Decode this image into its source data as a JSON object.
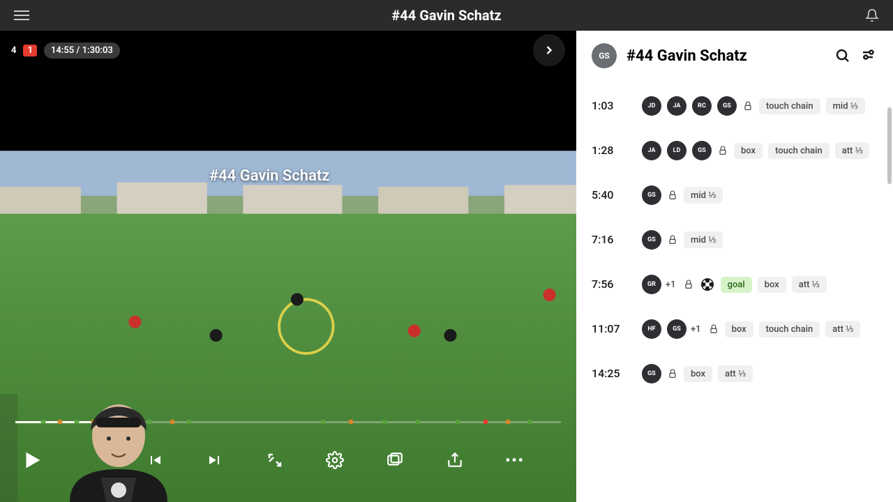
{
  "header": {
    "title": "#44 Gavin Schatz"
  },
  "video": {
    "score_a": "4",
    "score_b": "1",
    "time_current": "14:55",
    "time_total": "1:30:03",
    "overlay_title": "#44 Gavin Schatz"
  },
  "sidebar": {
    "avatar_initials": "GS",
    "title": "#44 Gavin Schatz"
  },
  "markers": [
    {
      "pos": 5,
      "color": "#5aa23a"
    },
    {
      "pos": 8,
      "color": "#d6852a"
    },
    {
      "pos": 11,
      "color": "#5aa23a"
    },
    {
      "pos": 14,
      "color": "#d6852a"
    },
    {
      "pos": 24,
      "color": "#5aa23a"
    },
    {
      "pos": 28,
      "color": "#d6852a"
    },
    {
      "pos": 31,
      "color": "#5aa23a"
    },
    {
      "pos": 55,
      "color": "#5aa23a"
    },
    {
      "pos": 60,
      "color": "#d6852a"
    },
    {
      "pos": 66,
      "color": "#5aa23a"
    },
    {
      "pos": 72,
      "color": "#5aa23a"
    },
    {
      "pos": 79,
      "color": "#5aa23a"
    },
    {
      "pos": 84,
      "color": "#e63b2e"
    },
    {
      "pos": 88,
      "color": "#d6852a"
    },
    {
      "pos": 92,
      "color": "#5aa23a"
    }
  ],
  "events": [
    {
      "time": "1:03",
      "avatars": [
        "JD",
        "JA",
        "RC",
        "GS"
      ],
      "plus": "",
      "ball": false,
      "tags": [
        "touch chain",
        "mid ⅓"
      ]
    },
    {
      "time": "1:28",
      "avatars": [
        "JA",
        "LD",
        "GS"
      ],
      "plus": "",
      "ball": false,
      "tags": [
        "box",
        "touch chain",
        "att ⅓"
      ]
    },
    {
      "time": "5:40",
      "avatars": [
        "GS"
      ],
      "plus": "",
      "ball": false,
      "tags": [
        "mid ⅓"
      ]
    },
    {
      "time": "7:16",
      "avatars": [
        "GS"
      ],
      "plus": "",
      "ball": false,
      "tags": [
        "mid ⅓"
      ]
    },
    {
      "time": "7:56",
      "avatars": [
        "GR"
      ],
      "plus": "+1",
      "ball": true,
      "tags": [
        "goal",
        "box",
        "att ⅓"
      ]
    },
    {
      "time": "11:07",
      "avatars": [
        "HF",
        "GS"
      ],
      "plus": "+1",
      "ball": false,
      "tags": [
        "box",
        "touch chain",
        "att ⅓"
      ]
    },
    {
      "time": "14:25",
      "avatars": [
        "GS"
      ],
      "plus": "",
      "ball": false,
      "tags": [
        "box",
        "att ⅓"
      ]
    }
  ]
}
